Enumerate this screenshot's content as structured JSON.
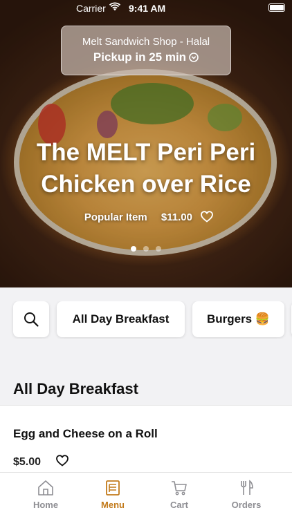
{
  "status_bar": {
    "carrier": "Carrier",
    "time": "9:41 AM",
    "wifi_icon": "wifi-icon",
    "battery_icon": "battery-icon"
  },
  "store": {
    "name": "Melt Sandwich Shop - Halal",
    "pickup": "Pickup in 25 min",
    "pickup_icon": "chevron-down-circle-icon"
  },
  "hero": {
    "title_line1": "The MELT Peri Peri",
    "title_line2": "Chicken over Rice",
    "badge": "Popular Item",
    "price": "$11.00",
    "favorite_icon": "heart-icon",
    "carousel_pages": 3,
    "carousel_active": 1
  },
  "categories": {
    "search_icon": "search-icon",
    "items": [
      {
        "label": "All Day Breakfast"
      },
      {
        "label": "Burgers 🍔"
      }
    ]
  },
  "section": {
    "title": "All Day Breakfast"
  },
  "menu_item": {
    "name": "Egg and Cheese on a Roll",
    "price": "$5.00",
    "favorite_icon": "heart-icon"
  },
  "tab_bar": {
    "tabs": [
      {
        "label": "Home",
        "icon": "home-icon",
        "active": false
      },
      {
        "label": "Menu",
        "icon": "menu-icon",
        "active": true
      },
      {
        "label": "Cart",
        "icon": "cart-icon",
        "active": false
      },
      {
        "label": "Orders",
        "icon": "utensils-icon",
        "active": false
      }
    ]
  },
  "colors": {
    "accent": "#c27a1a",
    "inactive_tab": "#8e8e93",
    "background": "#f2f2f4"
  }
}
